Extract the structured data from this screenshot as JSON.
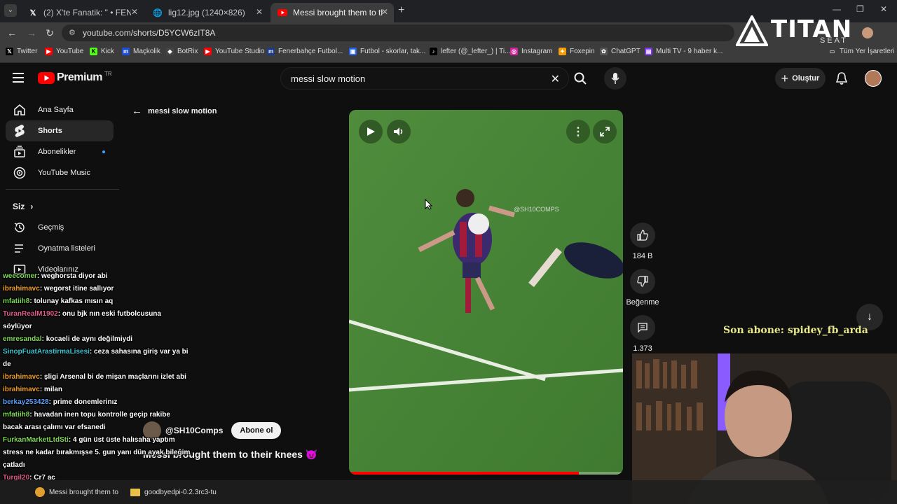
{
  "browser": {
    "tabs": [
      {
        "label": "(2) X'te Fanatik: \" • FENERBAH",
        "icon": "x-logo-icon",
        "active": false
      },
      {
        "label": "lig12.jpg (1240×826)",
        "icon": "globe-icon",
        "active": false
      },
      {
        "label": "Messi brought them to their kn",
        "icon": "youtube-icon",
        "active": true
      }
    ],
    "url": "youtube.com/shorts/D5YCW6zIT8A",
    "bookmarks": [
      "Twitter",
      "YouTube",
      "Kick",
      "Maçkolik",
      "BotRix",
      "YouTube Studio",
      "Fenerbahçe Futbol...",
      "Futbol - skorlar, tak...",
      "lefter (@_lefter_) | Ti...",
      "Instagram",
      "Foxepin",
      "ChatGPT",
      "Multi TV - 9 haber k..."
    ],
    "bookmarks_folder": "Tüm Yer İşaretleri",
    "colors": {
      "bg": "#202124",
      "toolbar": "#3c3c3c"
    }
  },
  "overlay": {
    "logo_text": "TITAN",
    "logo_sub": "SEAT",
    "last_sub_label": "Son abone: spidey_fb_arda"
  },
  "youtube": {
    "logo_text": "Premium",
    "logo_region": "TR",
    "search_value": "messi slow motion",
    "create_label": "Oluştur",
    "back_label": "messi slow motion",
    "sidebar": {
      "items": [
        {
          "label": "Ana Sayfa",
          "icon": "home-icon"
        },
        {
          "label": "Shorts",
          "icon": "shorts-icon",
          "active": true
        },
        {
          "label": "Abonelikler",
          "icon": "subscriptions-icon"
        },
        {
          "label": "YouTube Music",
          "icon": "music-icon"
        }
      ],
      "you_header": "Siz",
      "you_items": [
        {
          "label": "Geçmiş",
          "icon": "history-icon"
        },
        {
          "label": "Oynatma listeleri",
          "icon": "playlist-icon"
        },
        {
          "label": "Videolarınız",
          "icon": "videos-icon"
        }
      ]
    },
    "short": {
      "watermark": "@SH10COMPS",
      "channel": "@SH10Comps",
      "subscribe_label": "Abone ol",
      "title": "Messi brought them to their knees 😈",
      "likes": "184 B",
      "dislike_label": "Beğenme",
      "comments": "1.373",
      "progress": 0.84
    },
    "colors": {
      "accent": "#ff0000",
      "bg": "#0f0f0f"
    }
  },
  "chat": [
    {
      "user": "weecomer",
      "text": ": weghorsta diyor abi",
      "color": "#7ed957"
    },
    {
      "user": "ibrahimavc",
      "text": ": wegorst itine sallıyor",
      "color": "#f0a020"
    },
    {
      "user": "mfatiih8",
      "text": ": tolunay kafkas mısın aq",
      "color": "#7ed957"
    },
    {
      "user": "TuranRealM1902",
      "text": ": onu bjk nın eski futbolcusuna söylüyor",
      "color": "#e05a8a"
    },
    {
      "user": "emresandal",
      "text": ": kocaeli de aynı değilmiydi",
      "color": "#7ed957"
    },
    {
      "user": "SinopFuatArastirmaLisesi",
      "text": ": ceza sahasına giriş var ya bi de",
      "color": "#3ec6d4"
    },
    {
      "user": "ibrahimavc",
      "text": ": şligi Arsenal bi de mişan maçlarını izlet abi",
      "color": "#f0a020"
    },
    {
      "user": "ibrahimavc",
      "text": ": milan",
      "color": "#f0a020"
    },
    {
      "user": "berkay253428",
      "text": ": prime donemlerinız",
      "color": "#5aa0ff"
    },
    {
      "user": "mfatiih8",
      "text": ": havadan inen topu kontrolle geçip rakibe bacak arası çalımı var efsanedi",
      "color": "#7ed957"
    },
    {
      "user": "FurkanMarketLtdSti",
      "text": ": 4 gün üst üste halısaha yaptım stress ne kadar bırakmışse 5. gun yanı dün ayak bileğim çatladı",
      "color": "#7ed957"
    },
    {
      "user": "Turgil20",
      "text": ": Cr7 ac",
      "color": "#e05a8a"
    }
  ],
  "taskbar": {
    "items": [
      "Messi brought them to",
      "goodbyedpi-0.2.3rc3-tu"
    ]
  }
}
